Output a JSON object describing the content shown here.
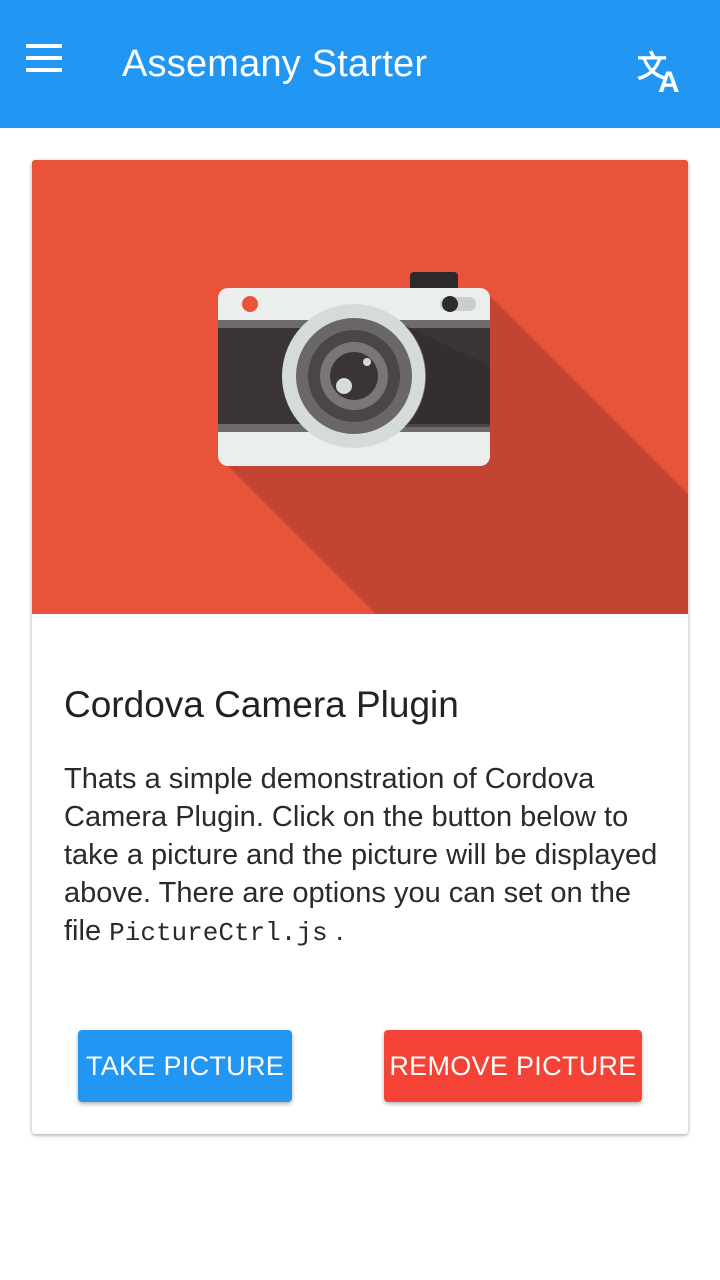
{
  "app_bar": {
    "title": "Assemany Starter",
    "menu_icon": "hamburger-menu-icon",
    "translate_icon": "translate-icon",
    "color": "#2196F3"
  },
  "card": {
    "image_icon": "camera-illustration",
    "image_bg": "#E8533A",
    "title": "Cordova Camera Plugin",
    "text_before": "Thats a simple demonstration of Cordova Camera Plugin. Click on the button below to take a picture and the picture will be displayed above. There are options you can set on the file",
    "code_file": "PictureCtrl.js",
    "text_after": ".",
    "take_button": "TAKE PICTURE",
    "remove_button": "REMOVE PICTURE",
    "take_color": "#2196F3",
    "remove_color": "#F44336"
  }
}
